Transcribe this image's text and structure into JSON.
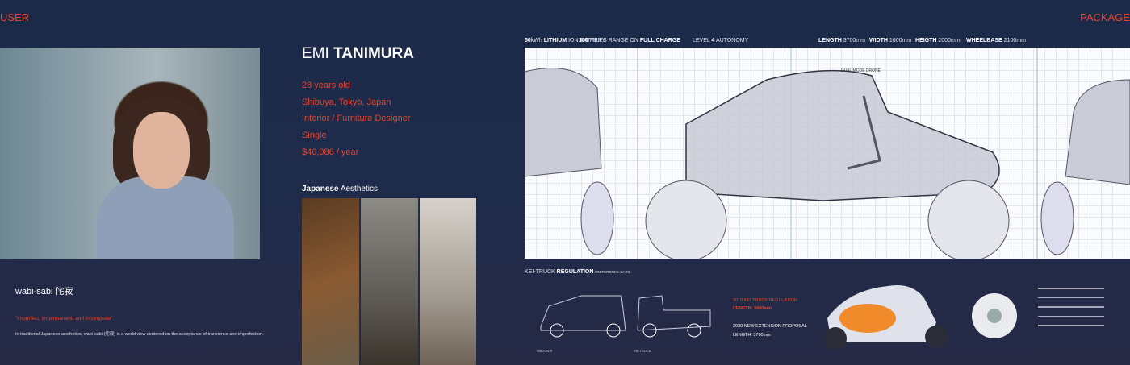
{
  "sections": {
    "user": "USER",
    "package": "PACKAGE"
  },
  "persona": {
    "first_name": "EMI",
    "last_name": "TANIMURA",
    "details": [
      "28 years old",
      "Shibuya, Tokyo, Japan",
      "Interior / Furniture Designer",
      "Single",
      "$46,086 / year"
    ]
  },
  "aesthetics": {
    "bold": "Japanese",
    "rest": " Aesthetics"
  },
  "wabi": {
    "title": "wabi-sabi 侘寂",
    "quote": "\"imperfect, impermanent, and incomplete\"",
    "body": "In traditional Japanese aesthetics, wabi-sabi (侘寂) is a world view centered on the acceptance of transience and imperfection."
  },
  "specs": {
    "battery_bold1": "50",
    "battery_unit": "kWh ",
    "battery_bold2": "LITHIUM",
    "battery_rest": " ION BATTERY",
    "range_bold": "300",
    "range_mid": " MILES RANGE ON ",
    "range_bold2": "FULL CHARGE",
    "autonomy_pre": "LEVEL ",
    "autonomy_bold": "4",
    "autonomy_post": " AUTONOMY",
    "length_label": "LENGTH",
    "length": " 3700mm",
    "width_label": "WIDTH",
    "width": " 1600mm",
    "height_label": "HEIGTH",
    "height": " 2000mm",
    "wheelbase_label": "WHEELBASE",
    "wheelbase": " 2100mm"
  },
  "sketch_label": "DUAL MODE DRONE",
  "kei": {
    "title_pre": "KEI-TRUCK ",
    "title_bold": "REGULATION",
    "title_post": " / REFERENCE CARS",
    "car1": "WAGON R",
    "car2": "KEI TRUCK",
    "reg1": "2018 KEI TRUCK REGULATION",
    "reg1_len": "LENGTH: 3400mm",
    "reg2": "2030 NEW EXTENSION PROPOSAL",
    "reg2_len": "LENGTH: 3700mm"
  },
  "colors": {
    "accent": "#e8432b",
    "background": "#1f2b4b"
  }
}
